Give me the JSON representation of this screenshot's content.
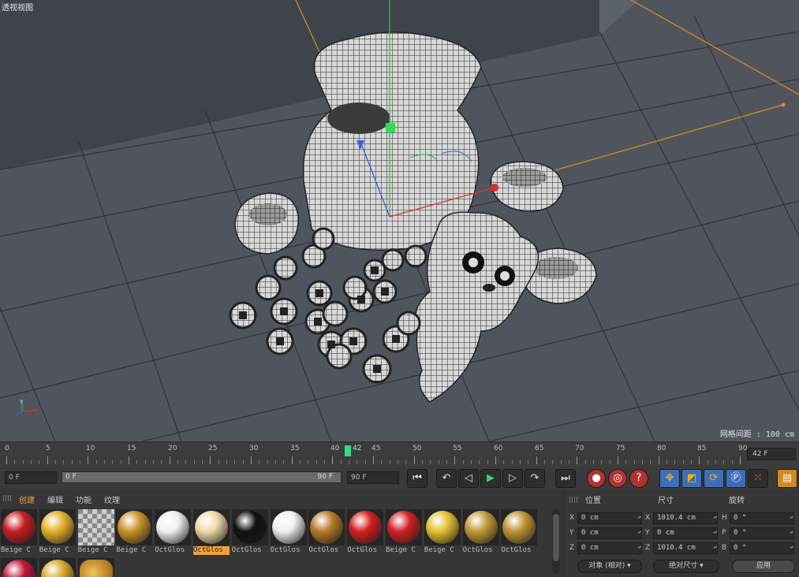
{
  "viewport": {
    "title": "透视视图",
    "grid_spacing": "网格间距 : 100 cm"
  },
  "timeline": {
    "ticks": [
      "0",
      "5",
      "10",
      "15",
      "20",
      "25",
      "30",
      "35",
      "40",
      "45",
      "50",
      "55",
      "60",
      "65",
      "70",
      "75",
      "80",
      "85",
      "90"
    ],
    "current_frame": "42",
    "end_frame_field": "42 F"
  },
  "transport": {
    "start_field": "0 F",
    "range_min": "0 F",
    "range_max": "90 F",
    "end_field": "90 F"
  },
  "materials": {
    "menu": [
      "创建",
      "编辑",
      "功能",
      "纹理"
    ],
    "items": [
      {
        "name": "Beige C",
        "color": "#c71c22"
      },
      {
        "name": "Beige C",
        "color": "#e2b22a"
      },
      {
        "name": "Beige C",
        "color": "checker"
      },
      {
        "name": "Beige C",
        "color": "#c8922a"
      },
      {
        "name": "OctGlos",
        "color": "#f0f0f0"
      },
      {
        "name": "OctGlos",
        "color": "#f0d9a8",
        "selected": true
      },
      {
        "name": "OctGlos",
        "color": "#111111"
      },
      {
        "name": "OctGlos",
        "color": "#efefef"
      },
      {
        "name": "OctGlos",
        "color": "#b57a2c"
      },
      {
        "name": "OctGlos",
        "color": "#d31e1e"
      },
      {
        "name": "Beige C",
        "color": "#d02024"
      },
      {
        "name": "Beige C",
        "color": "#e5c032"
      },
      {
        "name": "OctGlos",
        "color": "#c49a3a"
      },
      {
        "name": "OctGlos",
        "color": "#bf9532"
      }
    ],
    "row2": [
      {
        "color": "#c4143a"
      },
      {
        "color": "#d9a92a"
      },
      {
        "color": "coins"
      }
    ]
  },
  "coords": {
    "headers": {
      "position": "位置",
      "size": "尺寸",
      "rotation": "旋转"
    },
    "pos": {
      "x_label": "X",
      "y_label": "Y",
      "z_label": "Z",
      "x": "0 cm",
      "y": "0 cm",
      "z": "0 cm"
    },
    "size": {
      "x_label": "X",
      "y_label": "Y",
      "z_label": "Z",
      "x": "1010.4 cm",
      "y": "0 cm",
      "z": "1010.4 cm"
    },
    "rot": {
      "h_label": "H",
      "p_label": "P",
      "b_label": "B",
      "h": "0 °",
      "p": "0 °",
      "b": "0 °"
    },
    "mode": "对象 (相对)",
    "size_mode": "绝对尺寸",
    "apply": "应用"
  }
}
